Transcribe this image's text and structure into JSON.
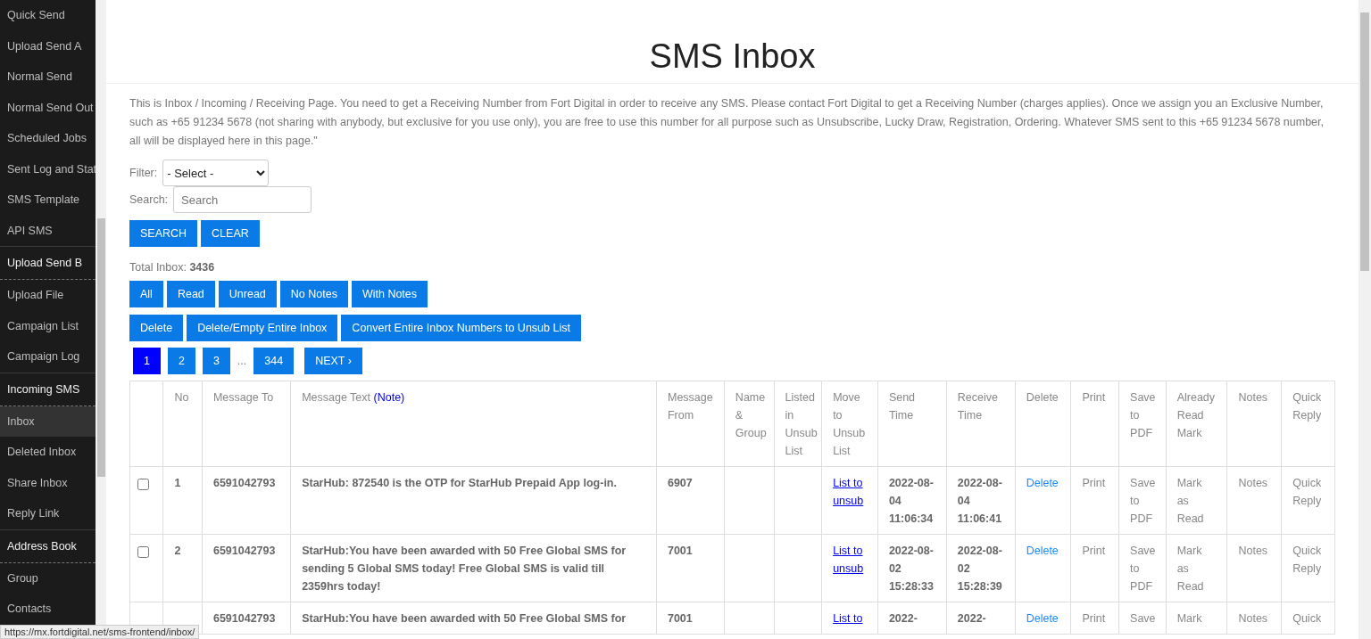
{
  "sidebar": {
    "items": [
      {
        "label": "Quick Send",
        "kind": "item",
        "selected": false
      },
      {
        "label": "Upload Send A",
        "kind": "item",
        "selected": false
      },
      {
        "label": "Normal Send",
        "kind": "item",
        "selected": false
      },
      {
        "label": "Normal Send Out",
        "kind": "item",
        "selected": false
      },
      {
        "label": "Scheduled Jobs",
        "kind": "item",
        "selected": false
      },
      {
        "label": "Sent Log and Stat",
        "kind": "item",
        "selected": false
      },
      {
        "label": "SMS Template",
        "kind": "item",
        "selected": false
      },
      {
        "label": "API SMS",
        "kind": "item",
        "selected": false
      },
      {
        "label": "Upload Send B",
        "kind": "header",
        "selected": false
      },
      {
        "label": "Upload File",
        "kind": "item",
        "selected": false
      },
      {
        "label": "Campaign List",
        "kind": "item",
        "selected": false
      },
      {
        "label": "Campaign Log",
        "kind": "item",
        "selected": false
      },
      {
        "label": "Incoming SMS",
        "kind": "header",
        "selected": false
      },
      {
        "label": "Inbox",
        "kind": "item",
        "selected": true
      },
      {
        "label": "Deleted Inbox",
        "kind": "item",
        "selected": false
      },
      {
        "label": "Share Inbox",
        "kind": "item",
        "selected": false
      },
      {
        "label": "Reply Link",
        "kind": "item",
        "selected": false
      },
      {
        "label": "Address Book",
        "kind": "header",
        "selected": false
      },
      {
        "label": "Group",
        "kind": "item",
        "selected": false
      },
      {
        "label": "Contacts",
        "kind": "item",
        "selected": false
      }
    ]
  },
  "status_url": "https://mx.fortdigital.net/sms-frontend/inbox/",
  "title": "SMS Inbox",
  "description": "This is Inbox / Incoming / Receiving Page. You need to get a Receiving Number from Fort Digital in order to receive any SMS. Please contact Fort Digital to get a Receiving Number (charges applies). Once we assign you an Exclusive Number, such as +65 91234 5678 (not sharing with anybody, but exclusive for you use only), you are free to use this number for all purpose such as Unsubscribe, Lucky Draw, Registration, Ordering. Whatever SMS sent to this +65 91234 5678 number, all will be displayed here in this page.\"",
  "filter": {
    "label": "Filter:",
    "value": "- Select -"
  },
  "search": {
    "label": "Search:",
    "placeholder": "Search"
  },
  "search_buttons": [
    "SEARCH",
    "CLEAR"
  ],
  "total": {
    "label": "Total Inbox:",
    "value": "3436"
  },
  "filter_buttons": [
    "All",
    "Read",
    "Unread",
    "No Notes",
    "With Notes"
  ],
  "action_buttons": [
    "Delete",
    "Delete/Empty Entire Inbox",
    "Convert Entire Inbox Numbers to Unsub List"
  ],
  "pagination": {
    "pages": [
      {
        "label": "1",
        "selected": true
      },
      {
        "label": "2",
        "selected": false
      },
      {
        "label": "3",
        "selected": false
      },
      {
        "label": "...",
        "kind": "ellipsis"
      },
      {
        "label": "344",
        "selected": false
      }
    ],
    "next": "NEXT ›"
  },
  "table": {
    "columns": [
      {
        "kind": "check"
      },
      {
        "label": "No",
        "kind": "bold"
      },
      {
        "label": "Message To",
        "kind": "bold"
      },
      {
        "label": "Message Text",
        "note": "(Note)",
        "kind": "bold"
      },
      {
        "label": "Message From",
        "kind": "bold"
      },
      {
        "label": "Name & Group",
        "kind": "plain"
      },
      {
        "label": "Listed in Unsub List",
        "kind": "plain"
      },
      {
        "label": "Move to Unsub List",
        "kind": "underline"
      },
      {
        "label": "Send Time",
        "kind": "bold"
      },
      {
        "label": "Receive Time",
        "kind": "bold"
      },
      {
        "label": "Delete",
        "kind": "link"
      },
      {
        "label": "Print",
        "kind": "plain"
      },
      {
        "label": "Save to PDF",
        "kind": "plain"
      },
      {
        "label": "Already Read Mark",
        "kind": "plain"
      },
      {
        "label": "Notes",
        "kind": "plain"
      },
      {
        "label": "Quick Reply",
        "kind": "plain"
      }
    ],
    "rows": [
      {
        "checked": false,
        "cells": [
          "",
          "1",
          "6591042793",
          "StarHub: 872540 is the OTP for StarHub Prepaid App log-in.",
          "6907",
          "",
          "",
          "List to unsub",
          "2022-08-04 11:06:34",
          "2022-08-04 11:06:41",
          "Delete",
          "Print",
          "Save to PDF",
          "Mark as Read",
          "Notes",
          "Quick Reply"
        ]
      },
      {
        "checked": false,
        "cells": [
          "",
          "2",
          "6591042793",
          "StarHub:You have been awarded with 50 Free Global SMS for sending 5 Global SMS today! Free Global SMS is valid till 2359hrs today!",
          "7001",
          "",
          "",
          "List to unsub",
          "2022-08-02 15:28:33",
          "2022-08-02 15:28:39",
          "Delete",
          "Print",
          "Save to PDF",
          "Mark as Read",
          "Notes",
          "Quick Reply"
        ]
      },
      {
        "cells": [
          "",
          "",
          "6591042793",
          "StarHub:You have been awarded with 50 Free Global SMS for",
          "7001",
          "",
          "",
          "List to",
          "2022-",
          "2022-",
          "Delete",
          "Print",
          "Save",
          "Mark",
          "Notes",
          "Quick"
        ]
      }
    ]
  }
}
